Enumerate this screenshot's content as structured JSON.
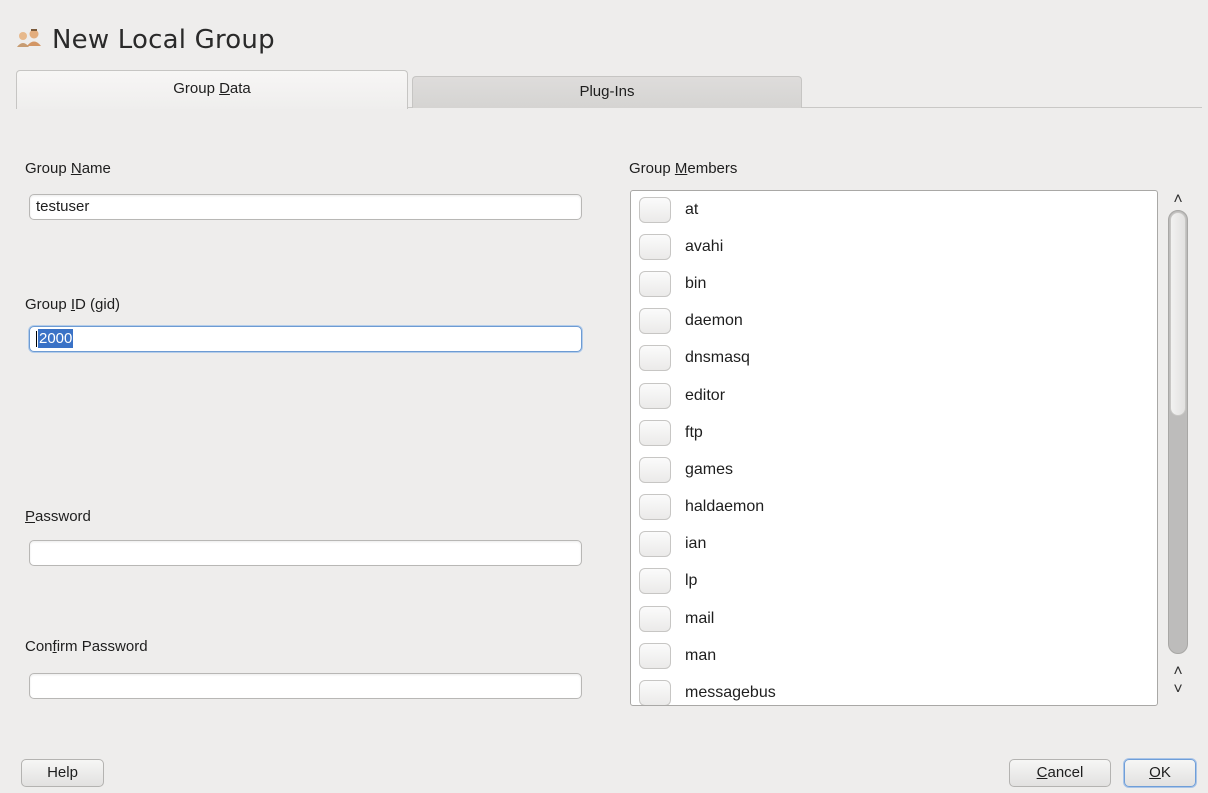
{
  "window": {
    "title": "New Local Group"
  },
  "tabs": [
    {
      "label_pre": "Group ",
      "mnemonic": "D",
      "label_post": "ata",
      "active": true
    },
    {
      "label_pre": "Plu",
      "mnemonic": "g",
      "label_post": "-Ins",
      "active": false
    }
  ],
  "form": {
    "group_name": {
      "label_pre": "Group ",
      "mnemonic": "N",
      "label_post": "ame",
      "value": "testuser"
    },
    "group_id": {
      "label_pre": "Group ",
      "mnemonic": "I",
      "label_post": "D (gid)",
      "value": "2000"
    },
    "password": {
      "label_pre": "",
      "mnemonic": "P",
      "label_post": "assword",
      "value": ""
    },
    "confirm_password": {
      "label_pre": "Con",
      "mnemonic": "f",
      "label_post": "irm Password",
      "value": ""
    }
  },
  "members": {
    "label_pre": "Group ",
    "mnemonic": "M",
    "label_post": "embers",
    "items": [
      "at",
      "avahi",
      "bin",
      "daemon",
      "dnsmasq",
      "editor",
      "ftp",
      "games",
      "haldaemon",
      "ian",
      "lp",
      "mail",
      "man",
      "messagebus"
    ],
    "scroll_fraction_visible": 0.45
  },
  "buttons": {
    "help": {
      "label": "Help"
    },
    "cancel": {
      "mnemonic": "C",
      "label_post": "ancel"
    },
    "ok": {
      "mnemonic": "O",
      "label_post": "K"
    }
  },
  "colors": {
    "selection": "#3a72c6",
    "focus_border": "#6d9bd3",
    "background": "#eeedec"
  }
}
